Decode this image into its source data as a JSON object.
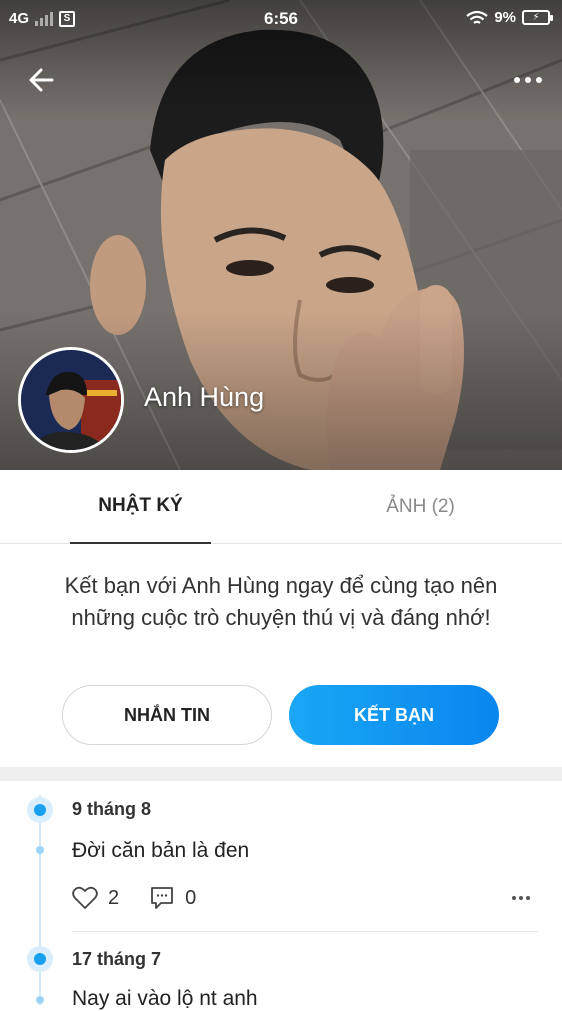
{
  "status_bar": {
    "network": "4G",
    "sim_icon": "S",
    "time": "6:56",
    "battery": "9%",
    "icons": [
      "signal-icon",
      "sim-icon",
      "wifi-icon",
      "battery-icon"
    ]
  },
  "header": {
    "back_icon": "arrow-left-icon",
    "more_icon": "more-horizontal-icon"
  },
  "profile": {
    "name": "Anh Hùng"
  },
  "tabs": [
    {
      "label": "NHẬT KÝ",
      "active": true
    },
    {
      "label": "ẢNH (2)",
      "active": false
    }
  ],
  "friend_prompt": {
    "text": "Kết bạn với Anh Hùng ngay để cùng tạo nên những cuộc trò chuyện thú vị và đáng nhớ!",
    "message_button": "NHẮN TIN",
    "add_friend_button": "KẾT BẠN"
  },
  "posts": [
    {
      "date": "9 tháng 8",
      "text": "Đời căn bản là đen",
      "likes": "2",
      "comments": "0"
    },
    {
      "date": "17 tháng 7",
      "text": "Nay ai vào lộ nt anh"
    }
  ],
  "colors": {
    "accent": "#1aa0f2",
    "button_gradient_start": "#1aa6f5",
    "button_gradient_end": "#0a86ee",
    "divider": "#efefef"
  }
}
